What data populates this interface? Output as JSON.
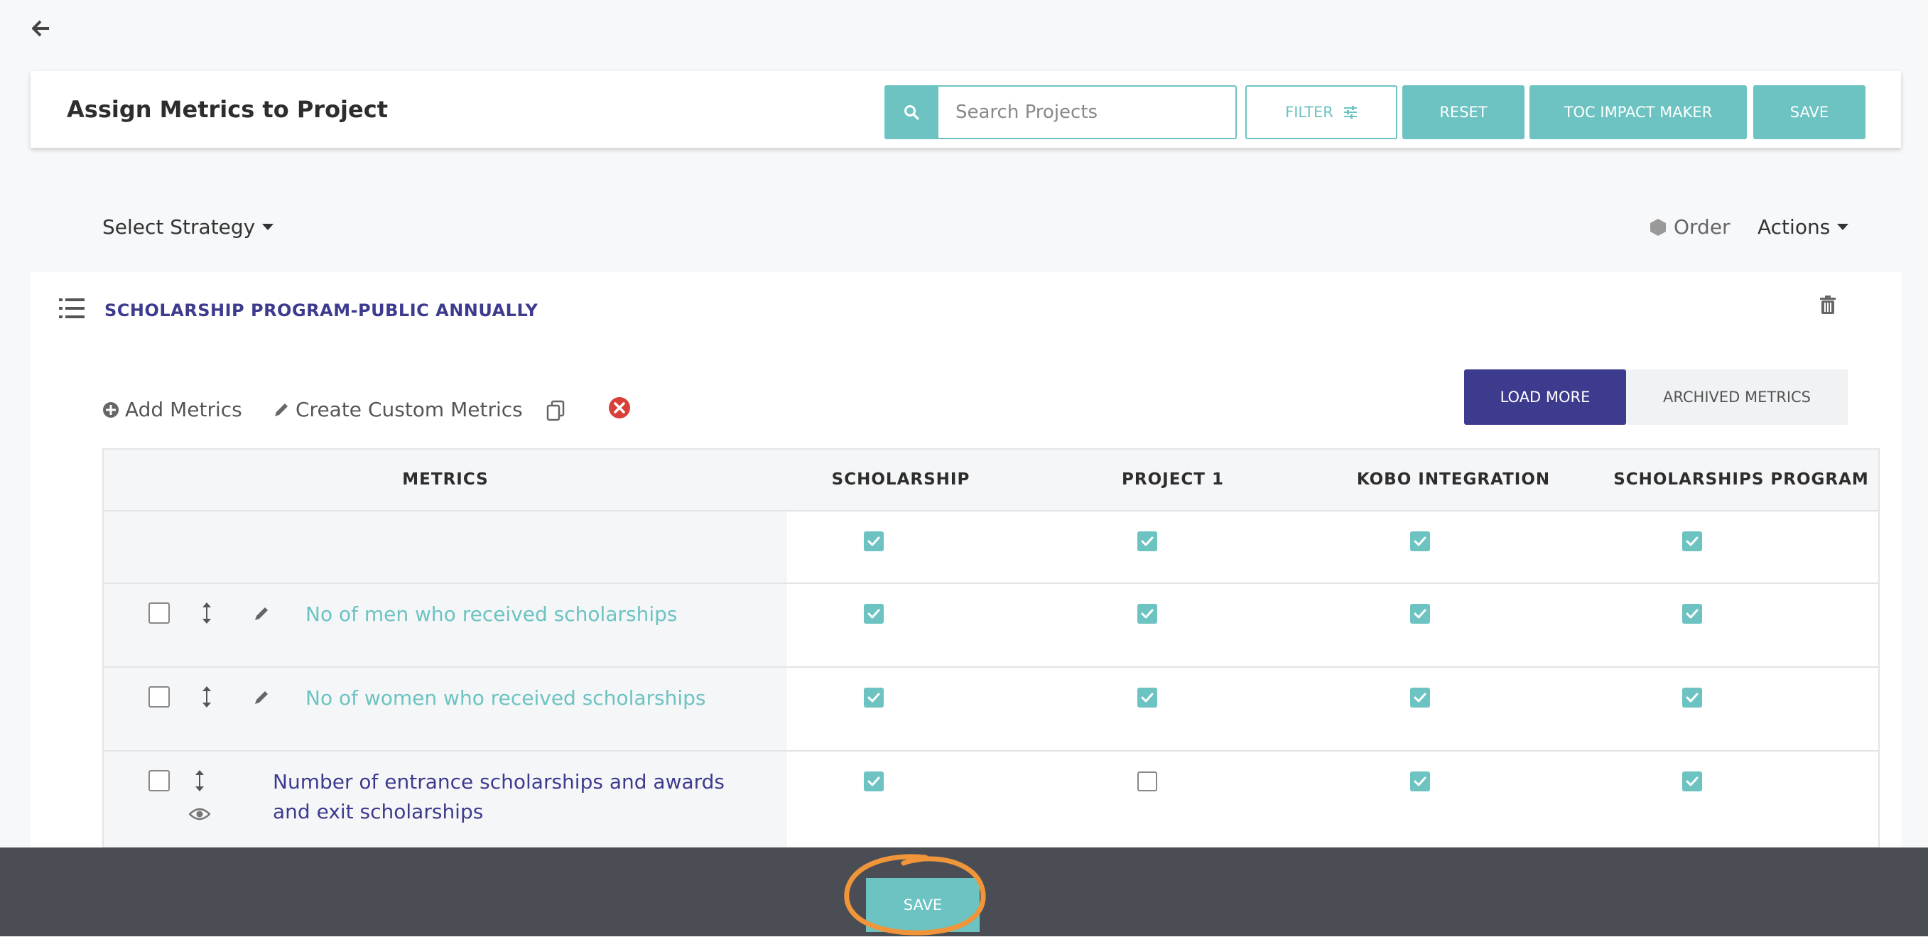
{
  "header": {
    "title": "Assign Metrics to Project",
    "search_placeholder": "Search Projects",
    "filter_label": "FILTER",
    "reset_label": "RESET",
    "toc_label": "TOC IMPACT MAKER",
    "save_label": "SAVE"
  },
  "toolbar": {
    "strategy_label": "Select Strategy",
    "order_label": "Order",
    "actions_label": "Actions"
  },
  "section": {
    "title": "SCHOLARSHIP PROGRAM-PUBLIC ANNUALLY",
    "add_metrics": "Add Metrics",
    "create_custom": "Create Custom Metrics",
    "load_more": "LOAD MORE",
    "archived_metrics": "ARCHIVED METRICS"
  },
  "table": {
    "columns": [
      "METRICS",
      "SCHOLARSHIP",
      "PROJECT 1",
      "KOBO INTEGRATION",
      "SCHOLARSHIPS PROGRAM"
    ],
    "select_all_row": [
      true,
      true,
      true,
      true
    ],
    "rows": [
      {
        "label": "No of men who received scholarships",
        "checks": [
          true,
          true,
          true,
          true
        ]
      },
      {
        "label": "No of women who received scholarships",
        "checks": [
          true,
          true,
          true,
          true
        ]
      },
      {
        "label": "Number of entrance scholarships and awards and exit scholarships",
        "checks": [
          true,
          false,
          true,
          true
        ]
      }
    ]
  },
  "footer": {
    "save_label": "SAVE"
  },
  "colors": {
    "teal": "#6cc3c1",
    "indigo": "#3d3b8e",
    "footer_bg": "#4a4e54",
    "annotation": "#f0953a",
    "danger": "#d9403a"
  }
}
